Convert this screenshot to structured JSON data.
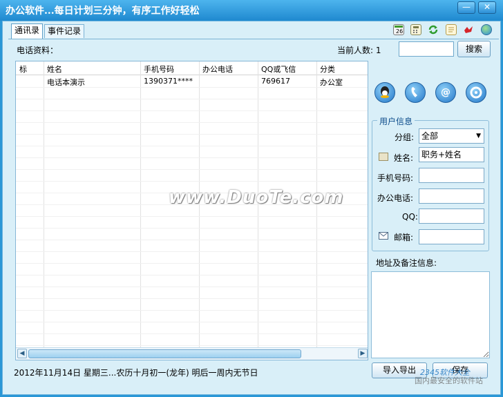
{
  "window": {
    "title": "办公软件...每日计划三分钟，有序工作好轻松",
    "min_label": "—",
    "close_label": "✕"
  },
  "tabs": [
    {
      "label": "通讯录"
    },
    {
      "label": "事件记录"
    }
  ],
  "toolbar_icons": [
    "calendar-icon",
    "calculator-icon",
    "refresh-icon",
    "notepad-icon",
    "bird-icon",
    "globe-icon"
  ],
  "phone": {
    "section_label": "电话资料：",
    "count_label": "当前人数:  1",
    "search_placeholder": "",
    "search_label": "搜索"
  },
  "grid": {
    "columns": [
      "标",
      "姓名",
      "手机号码",
      "办公电话",
      "QQ或飞信",
      "分类"
    ],
    "rows": [
      [
        "",
        "电话本演示",
        "1390371****",
        "",
        "769617",
        "办公室"
      ]
    ]
  },
  "user_info": {
    "legend": "用户信息",
    "group_label": "分组:",
    "group_value": "全部",
    "name_label": "姓名:",
    "name_value": "职务+姓名",
    "mobile_label": "手机号码:",
    "office_label": "办公电话:",
    "qq_label": "QQ:",
    "email_label": "邮箱:"
  },
  "note": {
    "label": "地址及备注信息:"
  },
  "status_text": "2012年11月14日  星期三...农历十月初一(龙年)   明后一周内无节日",
  "buttons": {
    "import_export": "导入导出",
    "save": "保存"
  },
  "watermark": {
    "main": "www.DuoTe.com",
    "corner1": "2345软件大全",
    "corner2": "国内最安全的软件站"
  }
}
